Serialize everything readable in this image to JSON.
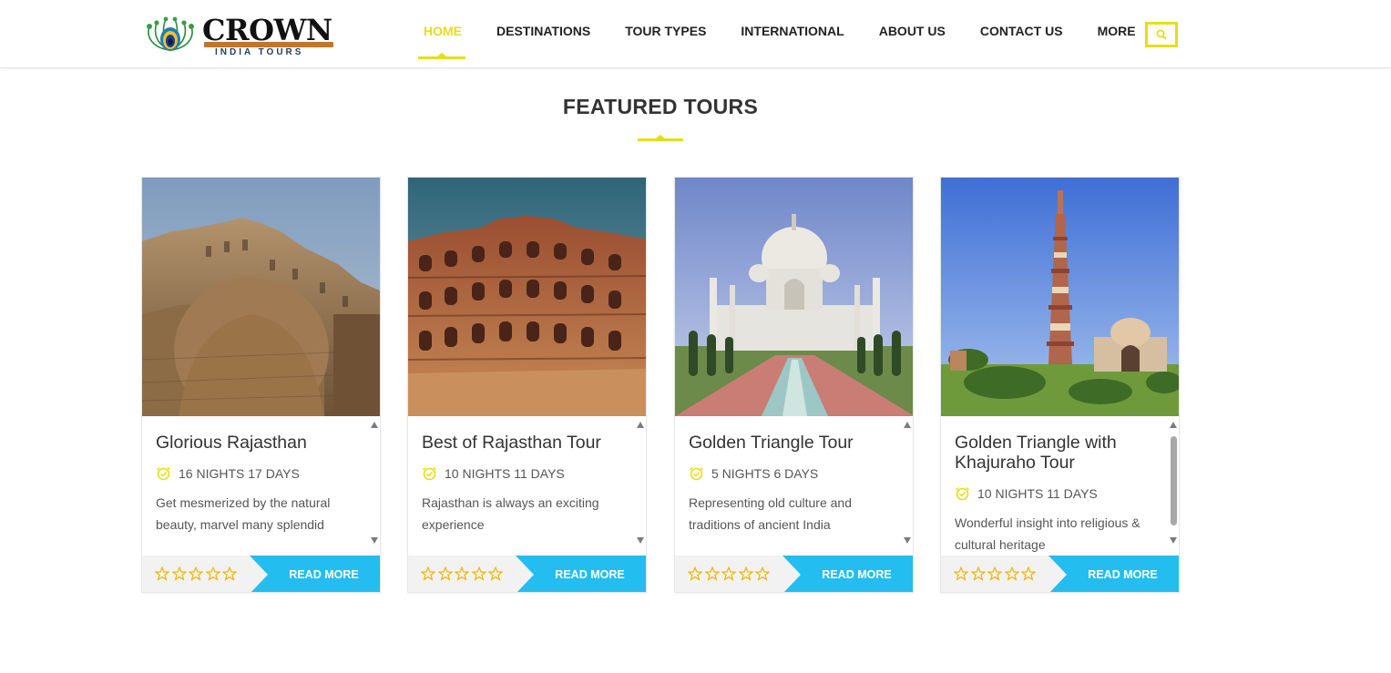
{
  "brand": {
    "name": "CROWN",
    "tagline": "INDIA TOURS",
    "logo_icon": "peacock-feather-icon",
    "accent_color": "#e6de16",
    "button_color": "#24bdef"
  },
  "nav": {
    "items": [
      {
        "label": "HOME",
        "active": true
      },
      {
        "label": "DESTINATIONS"
      },
      {
        "label": "TOUR TYPES"
      },
      {
        "label": "INTERNATIONAL"
      },
      {
        "label": "ABOUT US"
      },
      {
        "label": "CONTACT US"
      },
      {
        "label": "MORE"
      }
    ],
    "search_icon": "search-icon"
  },
  "section": {
    "title": "FEATURED TOURS"
  },
  "tours": [
    {
      "title": "Glorious Rajasthan",
      "duration": "16 NIGHTS 17 DAYS",
      "description": "Get mesmerized by the natural beauty, marvel many splendid",
      "image": "fort-photo",
      "rating": 0,
      "rating_max": 5,
      "button": "READ MORE"
    },
    {
      "title": "Best of Rajasthan Tour",
      "duration": "10 NIGHTS 11 DAYS",
      "description": "Rajasthan is always an exciting experience",
      "image": "palace-facade-photo",
      "rating": 0,
      "rating_max": 5,
      "button": "READ MORE"
    },
    {
      "title": "Golden Triangle Tour",
      "duration": "5 NIGHTS 6 DAYS",
      "description": "Representing old culture and traditions of ancient India",
      "image": "taj-mahal-photo",
      "rating": 0,
      "rating_max": 5,
      "button": "READ MORE"
    },
    {
      "title": "Golden Triangle with Khajuraho Tour",
      "duration": "10 NIGHTS 11 DAYS",
      "description": "Wonderful insight into religious & cultural heritage",
      "image": "qutub-minar-photo",
      "rating": 0,
      "rating_max": 5,
      "button": "READ MORE"
    }
  ]
}
